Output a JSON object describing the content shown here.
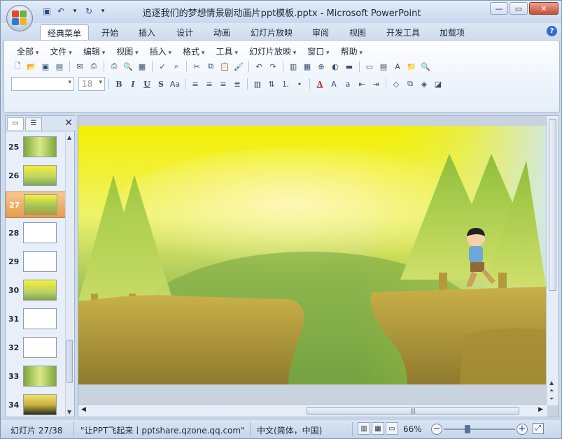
{
  "window": {
    "title": "追逐我们的梦想情景剧动画片ppt模板.pptx - Microsoft PowerPoint"
  },
  "qat": [
    {
      "icon": "save-icon",
      "glyph": "💾"
    },
    {
      "icon": "undo-icon",
      "glyph": "↶"
    },
    {
      "icon": "redo-icon",
      "glyph": "↷"
    },
    {
      "icon": "customize-icon",
      "glyph": "▾"
    }
  ],
  "tabs": [
    "经典菜单",
    "开始",
    "插入",
    "设计",
    "动画",
    "幻灯片放映",
    "审阅",
    "视图",
    "开发工具",
    "加载项"
  ],
  "active_tab": "经典菜单",
  "menus": [
    "全部",
    "文件",
    "编辑",
    "视图",
    "插入",
    "格式",
    "工具",
    "幻灯片放映",
    "窗口",
    "帮助"
  ],
  "format_bar": {
    "font_name": "",
    "font_size": "18",
    "bold": "B",
    "italic": "I",
    "underline": "U",
    "shadow": "S",
    "font_color": "A"
  },
  "slides": [
    {
      "num": "25",
      "kind": "forest"
    },
    {
      "num": "26",
      "kind": "field"
    },
    {
      "num": "27",
      "kind": "scene",
      "selected": true
    },
    {
      "num": "28",
      "kind": "blank"
    },
    {
      "num": "29",
      "kind": "blank"
    },
    {
      "num": "30",
      "kind": "field"
    },
    {
      "num": "31",
      "kind": "blank"
    },
    {
      "num": "32",
      "kind": "blank"
    },
    {
      "num": "33",
      "kind": "forest"
    },
    {
      "num": "34",
      "kind": "dark"
    }
  ],
  "status": {
    "slide_info": "幻灯片 27/38",
    "theme": "\"让PPT飞起来丨pptshare.qzone.qq.com\"",
    "language": "中文(简体，中国)",
    "zoom": "66%",
    "zoom_level": 0.33
  },
  "colors": {
    "selected_thumb": "#e79c4a",
    "ribbon_border": "#a8bbd6",
    "sky": "#f2f200",
    "grass": "#7fa64a"
  }
}
